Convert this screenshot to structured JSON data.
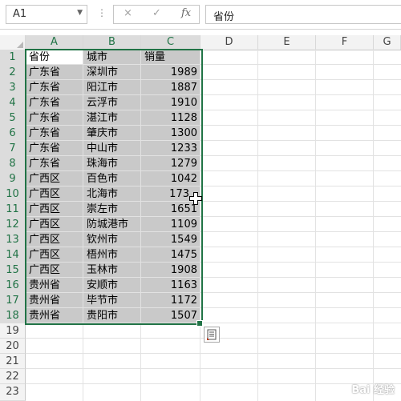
{
  "formula_bar": {
    "name_box": "A1",
    "fx_label": "fx",
    "cancel_symbol": "×",
    "enter_symbol": "✓",
    "content": "省份"
  },
  "columns": [
    "A",
    "B",
    "C",
    "D",
    "E",
    "F",
    "G"
  ],
  "rows": [
    "1",
    "2",
    "3",
    "4",
    "5",
    "6",
    "7",
    "8",
    "9",
    "10",
    "11",
    "12",
    "13",
    "14",
    "15",
    "16",
    "17",
    "18",
    "19",
    "20",
    "21",
    "22",
    "23",
    "24"
  ],
  "table": {
    "header": [
      "省份",
      "城市",
      "销量"
    ],
    "rows": [
      [
        "广东省",
        "深圳市",
        "1989"
      ],
      [
        "广东省",
        "阳江市",
        "1887"
      ],
      [
        "广东省",
        "云浮市",
        "1910"
      ],
      [
        "广东省",
        "湛江市",
        "1128"
      ],
      [
        "广东省",
        "肇庆市",
        "1300"
      ],
      [
        "广东省",
        "中山市",
        "1233"
      ],
      [
        "广东省",
        "珠海市",
        "1279"
      ],
      [
        "广西区",
        "百色市",
        "1042"
      ],
      [
        "广西区",
        "北海市",
        "173"
      ],
      [
        "广西区",
        "崇左市",
        "1651"
      ],
      [
        "广西区",
        "防城港市",
        "1109"
      ],
      [
        "广西区",
        "钦州市",
        "1549"
      ],
      [
        "广西区",
        "梧州市",
        "1475"
      ],
      [
        "广西区",
        "玉林市",
        "1908"
      ],
      [
        "贵州省",
        "安顺市",
        "1163"
      ],
      [
        "贵州省",
        "毕节市",
        "1172"
      ],
      [
        "贵州省",
        "贵阳市",
        "1507"
      ]
    ]
  },
  "watermark": "Bai 经验",
  "colors": {
    "accent": "#217346",
    "selection": "#c9c9c9"
  }
}
